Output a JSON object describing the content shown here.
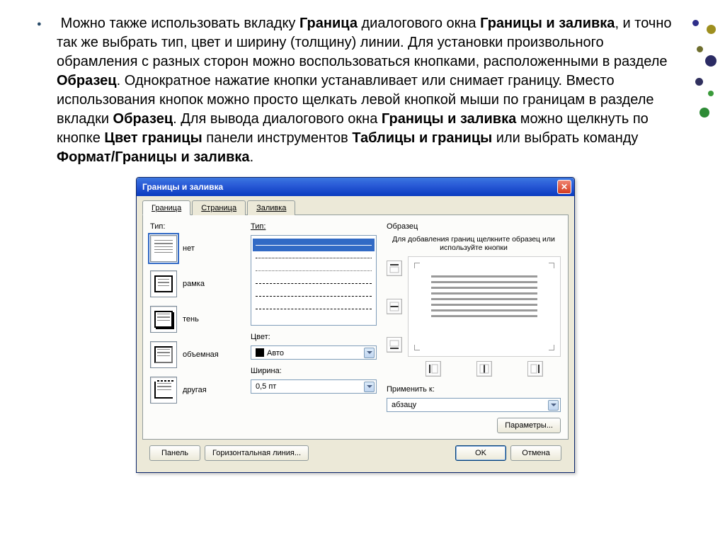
{
  "paragraph": {
    "t0a": "Можно также использовать вкладку ",
    "b0": "Граница",
    "t0b": " диалогового окна ",
    "b1": "Границы и заливка",
    "t1": ", и точно так же выбрать тип, цвет и ширину (толщину) линии. Для установки произвольного обрамления с разных сторон можно воспользоваться кнопками, расположенными в разделе ",
    "b2": "Образец",
    "t2": ". Однократное нажатие кнопки устанавливает или снимает границу. Вместо использования кнопок можно просто щелкать левой кнопкой мыши по границам в разделе вкладки ",
    "b3": "Образец",
    "t3": ". Для вывода диалогового окна ",
    "b4": "Границы и заливка",
    "t4": " можно щелкнуть по кнопке ",
    "b5": "Цвет границы",
    "t5": " панели инструментов ",
    "b6": "Таблицы и границы",
    "t6": " или выбрать команду ",
    "b7": "Формат/Границы и заливка",
    "t7": "."
  },
  "dialog": {
    "title": "Границы и заливка",
    "tabs": {
      "border": "Граница",
      "page": "Страница",
      "fill": "Заливка"
    },
    "col1_label": "Тип:",
    "presets": {
      "none": "нет",
      "box": "рамка",
      "shadow": "тень",
      "threeD": "объемная",
      "custom": "другая"
    },
    "col2": {
      "style_label": "Тип:",
      "color_label": "Цвет:",
      "color_value": "Авто",
      "width_label": "Ширина:",
      "width_value": "0,5 пт"
    },
    "col3": {
      "sample_label": "Образец",
      "hint": "Для добавления границ щелкните образец или используйте кнопки",
      "apply_label": "Применить к:",
      "apply_value": "абзацу",
      "params_btn": "Параметры..."
    },
    "footer": {
      "panel": "Панель",
      "hline": "Горизонтальная линия...",
      "ok": "OK",
      "cancel": "Отмена"
    }
  }
}
